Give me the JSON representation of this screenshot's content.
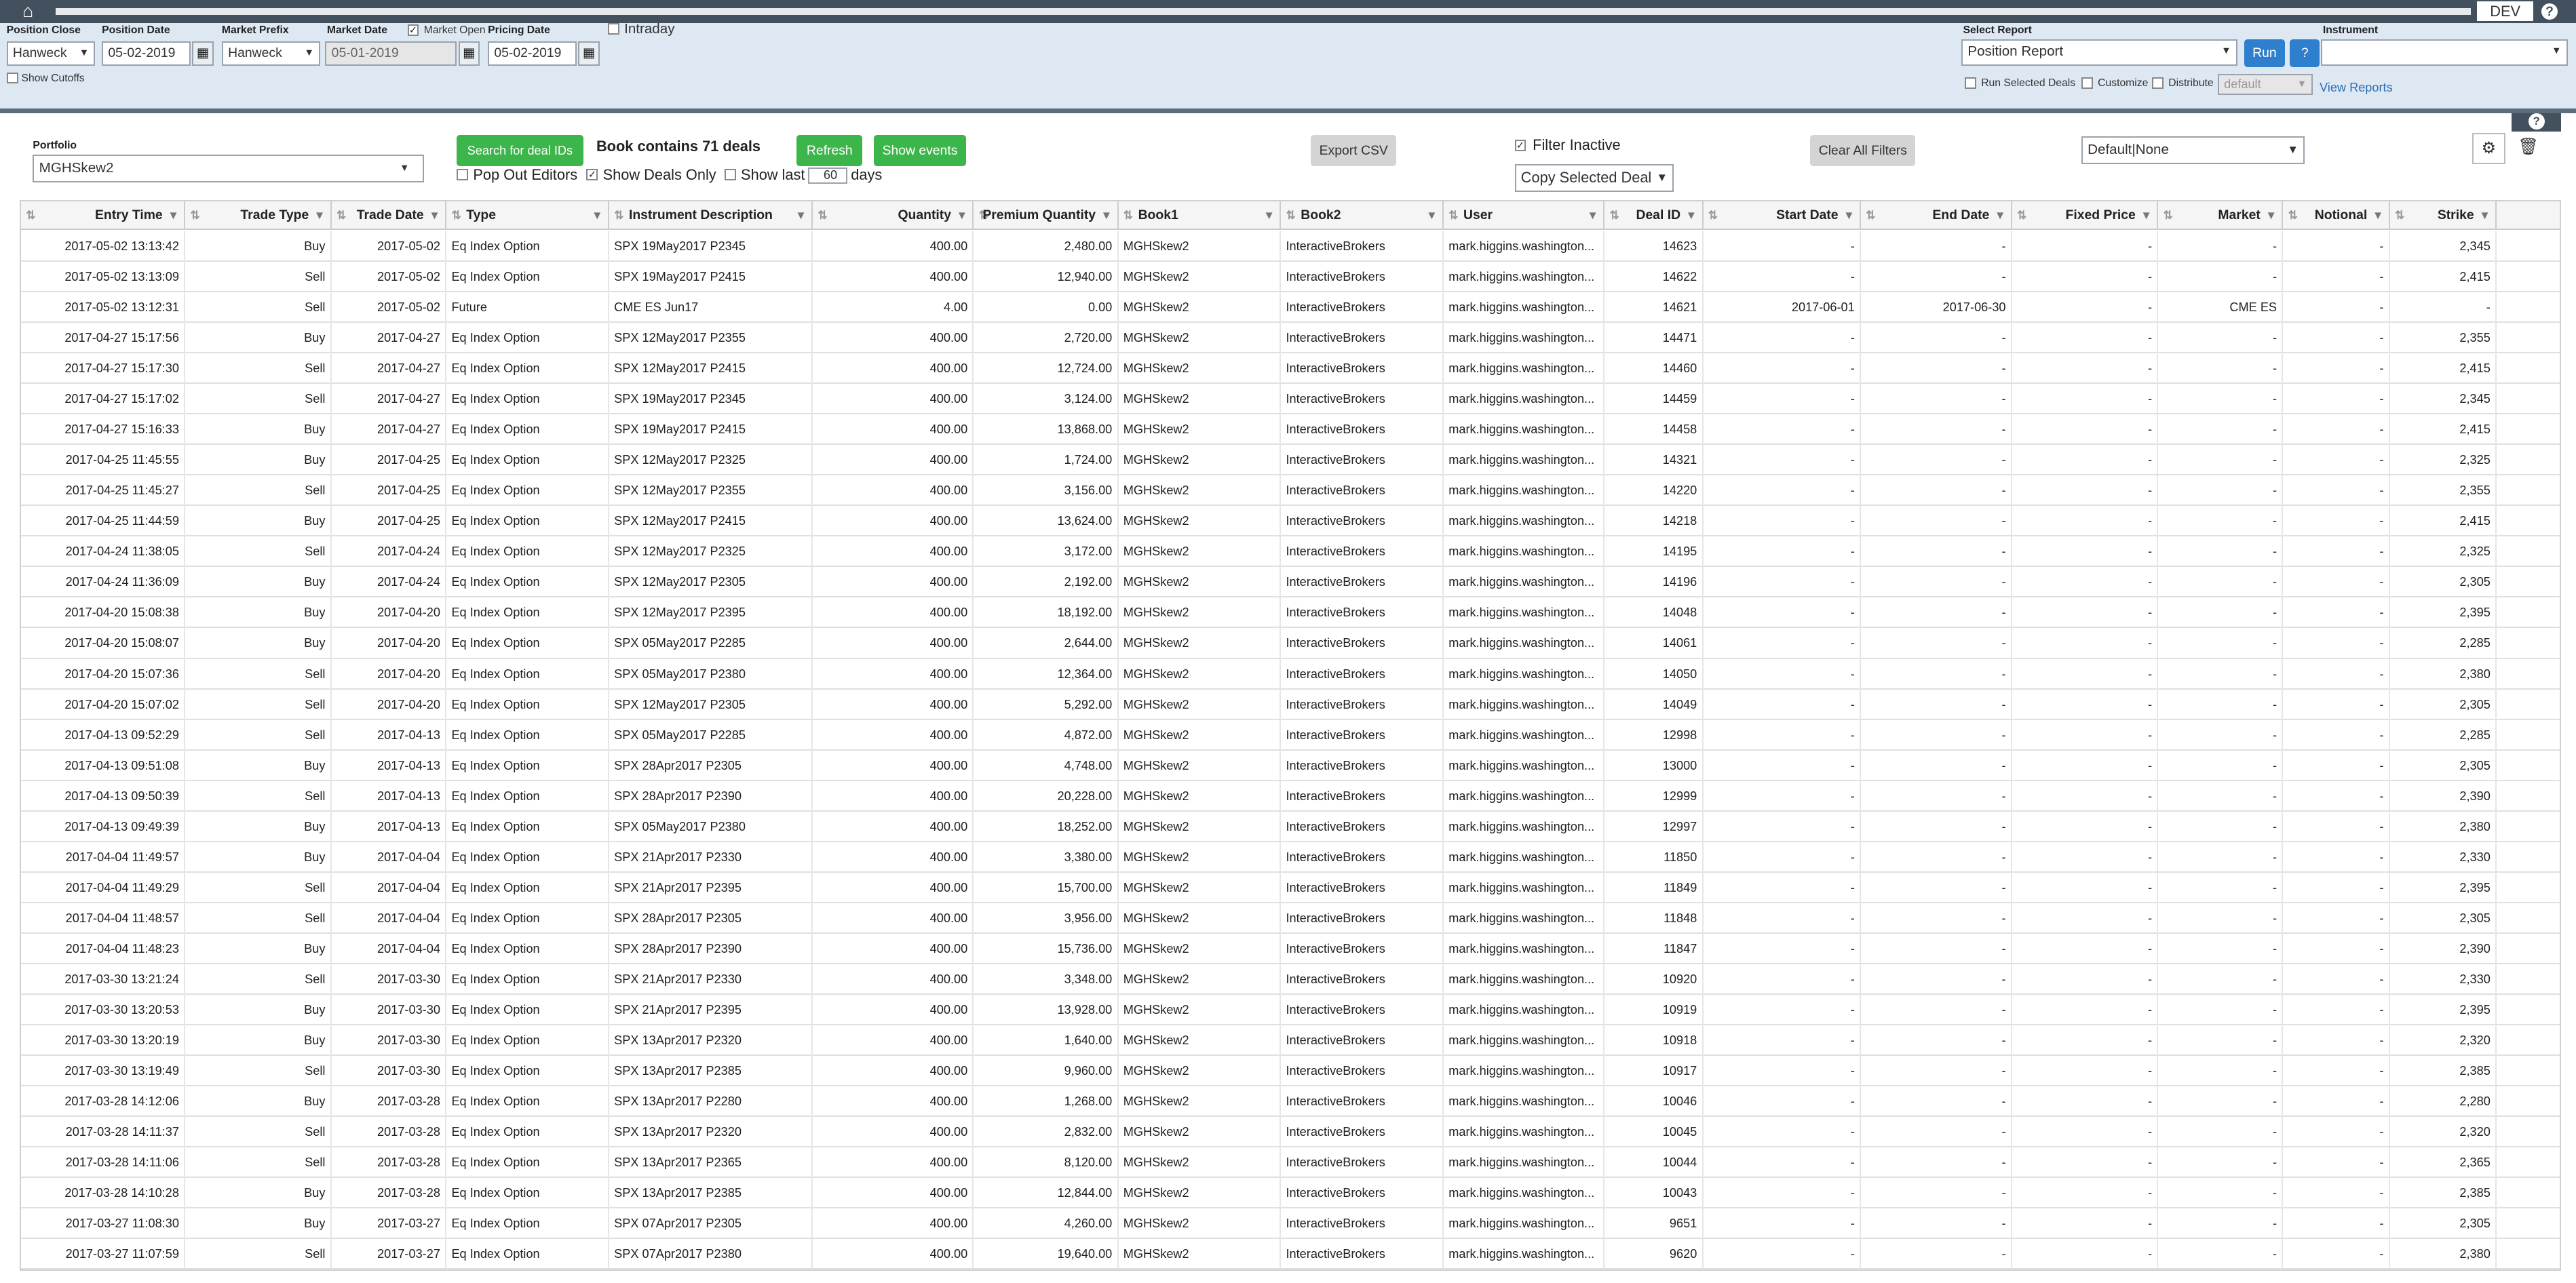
{
  "topbar": {
    "home_icon": "home-icon",
    "env": "DEV",
    "help": "?"
  },
  "filters": {
    "position_close": {
      "label": "Position Close",
      "value": "Hanweck"
    },
    "position_date": {
      "label": "Position Date",
      "value": "05-02-2019"
    },
    "market_prefix": {
      "label": "Market Prefix",
      "value": "Hanweck"
    },
    "market_date": {
      "label": "Market Date",
      "value": "05-01-2019"
    },
    "market_open": {
      "label": "Market Open",
      "checked": true
    },
    "pricing_date": {
      "label": "Pricing Date",
      "value": "05-02-2019"
    },
    "intraday": {
      "label": "Intraday",
      "checked": false
    },
    "show_cutoffs": {
      "label": "Show Cutoffs",
      "checked": false
    }
  },
  "report": {
    "label": "Select Report",
    "value": "Position Report",
    "run": "Run",
    "help": "?",
    "instrument_label": "Instrument",
    "instrument_value": "",
    "run_selected": "Run Selected Deals",
    "customize": "Customize",
    "distribute": "Distribute",
    "distribute_value": "default",
    "view_reports": "View Reports"
  },
  "toolbar": {
    "portfolio_label": "Portfolio",
    "portfolio_value": "MGHSkew2",
    "search_deal_ids": "Search for deal IDs",
    "book_info": "Book contains 71 deals",
    "refresh": "Refresh",
    "show_events": "Show events",
    "pop_out_editors": "Pop Out Editors",
    "show_deals_only": "Show Deals Only",
    "show_last": "Show last",
    "show_last_days": "60",
    "days": "days",
    "export_csv": "Export CSV",
    "filter_inactive": "Filter Inactive",
    "copy_selected_deal": "Copy Selected Deal",
    "clear_all_filters": "Clear All Filters",
    "layout_value": "Default|None"
  },
  "grid": {
    "columns": [
      "Entry Time",
      "Trade Type",
      "Trade Date",
      "Type",
      "Instrument Description",
      "Quantity",
      "Premium Quantity",
      "Book1",
      "Book2",
      "User",
      "Deal ID",
      "Start Date",
      "End Date",
      "Fixed Price",
      "Market",
      "Notional",
      "Strike"
    ],
    "rows": [
      [
        "2017-05-02 13:13:42",
        "Buy",
        "2017-05-02",
        "Eq Index Option",
        "SPX 19May2017 P2345",
        "400.00",
        "2,480.00",
        "MGHSkew2",
        "InteractiveBrokers",
        "mark.higgins.washington...",
        "14623",
        "-",
        "-",
        "-",
        "-",
        "-",
        "2,345"
      ],
      [
        "2017-05-02 13:13:09",
        "Sell",
        "2017-05-02",
        "Eq Index Option",
        "SPX 19May2017 P2415",
        "400.00",
        "12,940.00",
        "MGHSkew2",
        "InteractiveBrokers",
        "mark.higgins.washington...",
        "14622",
        "-",
        "-",
        "-",
        "-",
        "-",
        "2,415"
      ],
      [
        "2017-05-02 13:12:31",
        "Sell",
        "2017-05-02",
        "Future",
        "CME ES Jun17",
        "4.00",
        "0.00",
        "MGHSkew2",
        "InteractiveBrokers",
        "mark.higgins.washington...",
        "14621",
        "2017-06-01",
        "2017-06-30",
        "-",
        "CME ES",
        "-",
        "-"
      ],
      [
        "2017-04-27 15:17:56",
        "Buy",
        "2017-04-27",
        "Eq Index Option",
        "SPX 12May2017 P2355",
        "400.00",
        "2,720.00",
        "MGHSkew2",
        "InteractiveBrokers",
        "mark.higgins.washington...",
        "14471",
        "-",
        "-",
        "-",
        "-",
        "-",
        "2,355"
      ],
      [
        "2017-04-27 15:17:30",
        "Sell",
        "2017-04-27",
        "Eq Index Option",
        "SPX 12May2017 P2415",
        "400.00",
        "12,724.00",
        "MGHSkew2",
        "InteractiveBrokers",
        "mark.higgins.washington...",
        "14460",
        "-",
        "-",
        "-",
        "-",
        "-",
        "2,415"
      ],
      [
        "2017-04-27 15:17:02",
        "Sell",
        "2017-04-27",
        "Eq Index Option",
        "SPX 19May2017 P2345",
        "400.00",
        "3,124.00",
        "MGHSkew2",
        "InteractiveBrokers",
        "mark.higgins.washington...",
        "14459",
        "-",
        "-",
        "-",
        "-",
        "-",
        "2,345"
      ],
      [
        "2017-04-27 15:16:33",
        "Buy",
        "2017-04-27",
        "Eq Index Option",
        "SPX 19May2017 P2415",
        "400.00",
        "13,868.00",
        "MGHSkew2",
        "InteractiveBrokers",
        "mark.higgins.washington...",
        "14458",
        "-",
        "-",
        "-",
        "-",
        "-",
        "2,415"
      ],
      [
        "2017-04-25 11:45:55",
        "Buy",
        "2017-04-25",
        "Eq Index Option",
        "SPX 12May2017 P2325",
        "400.00",
        "1,724.00",
        "MGHSkew2",
        "InteractiveBrokers",
        "mark.higgins.washington...",
        "14321",
        "-",
        "-",
        "-",
        "-",
        "-",
        "2,325"
      ],
      [
        "2017-04-25 11:45:27",
        "Sell",
        "2017-04-25",
        "Eq Index Option",
        "SPX 12May2017 P2355",
        "400.00",
        "3,156.00",
        "MGHSkew2",
        "InteractiveBrokers",
        "mark.higgins.washington...",
        "14220",
        "-",
        "-",
        "-",
        "-",
        "-",
        "2,355"
      ],
      [
        "2017-04-25 11:44:59",
        "Buy",
        "2017-04-25",
        "Eq Index Option",
        "SPX 12May2017 P2415",
        "400.00",
        "13,624.00",
        "MGHSkew2",
        "InteractiveBrokers",
        "mark.higgins.washington...",
        "14218",
        "-",
        "-",
        "-",
        "-",
        "-",
        "2,415"
      ],
      [
        "2017-04-24 11:38:05",
        "Sell",
        "2017-04-24",
        "Eq Index Option",
        "SPX 12May2017 P2325",
        "400.00",
        "3,172.00",
        "MGHSkew2",
        "InteractiveBrokers",
        "mark.higgins.washington...",
        "14195",
        "-",
        "-",
        "-",
        "-",
        "-",
        "2,325"
      ],
      [
        "2017-04-24 11:36:09",
        "Buy",
        "2017-04-24",
        "Eq Index Option",
        "SPX 12May2017 P2305",
        "400.00",
        "2,192.00",
        "MGHSkew2",
        "InteractiveBrokers",
        "mark.higgins.washington...",
        "14196",
        "-",
        "-",
        "-",
        "-",
        "-",
        "2,305"
      ],
      [
        "2017-04-20 15:08:38",
        "Buy",
        "2017-04-20",
        "Eq Index Option",
        "SPX 12May2017 P2395",
        "400.00",
        "18,192.00",
        "MGHSkew2",
        "InteractiveBrokers",
        "mark.higgins.washington...",
        "14048",
        "-",
        "-",
        "-",
        "-",
        "-",
        "2,395"
      ],
      [
        "2017-04-20 15:08:07",
        "Buy",
        "2017-04-20",
        "Eq Index Option",
        "SPX 05May2017 P2285",
        "400.00",
        "2,644.00",
        "MGHSkew2",
        "InteractiveBrokers",
        "mark.higgins.washington...",
        "14061",
        "-",
        "-",
        "-",
        "-",
        "-",
        "2,285"
      ],
      [
        "2017-04-20 15:07:36",
        "Sell",
        "2017-04-20",
        "Eq Index Option",
        "SPX 05May2017 P2380",
        "400.00",
        "12,364.00",
        "MGHSkew2",
        "InteractiveBrokers",
        "mark.higgins.washington...",
        "14050",
        "-",
        "-",
        "-",
        "-",
        "-",
        "2,380"
      ],
      [
        "2017-04-20 15:07:02",
        "Sell",
        "2017-04-20",
        "Eq Index Option",
        "SPX 12May2017 P2305",
        "400.00",
        "5,292.00",
        "MGHSkew2",
        "InteractiveBrokers",
        "mark.higgins.washington...",
        "14049",
        "-",
        "-",
        "-",
        "-",
        "-",
        "2,305"
      ],
      [
        "2017-04-13 09:52:29",
        "Sell",
        "2017-04-13",
        "Eq Index Option",
        "SPX 05May2017 P2285",
        "400.00",
        "4,872.00",
        "MGHSkew2",
        "InteractiveBrokers",
        "mark.higgins.washington...",
        "12998",
        "-",
        "-",
        "-",
        "-",
        "-",
        "2,285"
      ],
      [
        "2017-04-13 09:51:08",
        "Buy",
        "2017-04-13",
        "Eq Index Option",
        "SPX 28Apr2017 P2305",
        "400.00",
        "4,748.00",
        "MGHSkew2",
        "InteractiveBrokers",
        "mark.higgins.washington...",
        "13000",
        "-",
        "-",
        "-",
        "-",
        "-",
        "2,305"
      ],
      [
        "2017-04-13 09:50:39",
        "Sell",
        "2017-04-13",
        "Eq Index Option",
        "SPX 28Apr2017 P2390",
        "400.00",
        "20,228.00",
        "MGHSkew2",
        "InteractiveBrokers",
        "mark.higgins.washington...",
        "12999",
        "-",
        "-",
        "-",
        "-",
        "-",
        "2,390"
      ],
      [
        "2017-04-13 09:49:39",
        "Buy",
        "2017-04-13",
        "Eq Index Option",
        "SPX 05May2017 P2380",
        "400.00",
        "18,252.00",
        "MGHSkew2",
        "InteractiveBrokers",
        "mark.higgins.washington...",
        "12997",
        "-",
        "-",
        "-",
        "-",
        "-",
        "2,380"
      ],
      [
        "2017-04-04 11:49:57",
        "Buy",
        "2017-04-04",
        "Eq Index Option",
        "SPX 21Apr2017 P2330",
        "400.00",
        "3,380.00",
        "MGHSkew2",
        "InteractiveBrokers",
        "mark.higgins.washington...",
        "11850",
        "-",
        "-",
        "-",
        "-",
        "-",
        "2,330"
      ],
      [
        "2017-04-04 11:49:29",
        "Sell",
        "2017-04-04",
        "Eq Index Option",
        "SPX 21Apr2017 P2395",
        "400.00",
        "15,700.00",
        "MGHSkew2",
        "InteractiveBrokers",
        "mark.higgins.washington...",
        "11849",
        "-",
        "-",
        "-",
        "-",
        "-",
        "2,395"
      ],
      [
        "2017-04-04 11:48:57",
        "Sell",
        "2017-04-04",
        "Eq Index Option",
        "SPX 28Apr2017 P2305",
        "400.00",
        "3,956.00",
        "MGHSkew2",
        "InteractiveBrokers",
        "mark.higgins.washington...",
        "11848",
        "-",
        "-",
        "-",
        "-",
        "-",
        "2,305"
      ],
      [
        "2017-04-04 11:48:23",
        "Buy",
        "2017-04-04",
        "Eq Index Option",
        "SPX 28Apr2017 P2390",
        "400.00",
        "15,736.00",
        "MGHSkew2",
        "InteractiveBrokers",
        "mark.higgins.washington...",
        "11847",
        "-",
        "-",
        "-",
        "-",
        "-",
        "2,390"
      ],
      [
        "2017-03-30 13:21:24",
        "Sell",
        "2017-03-30",
        "Eq Index Option",
        "SPX 21Apr2017 P2330",
        "400.00",
        "3,348.00",
        "MGHSkew2",
        "InteractiveBrokers",
        "mark.higgins.washington...",
        "10920",
        "-",
        "-",
        "-",
        "-",
        "-",
        "2,330"
      ],
      [
        "2017-03-30 13:20:53",
        "Buy",
        "2017-03-30",
        "Eq Index Option",
        "SPX 21Apr2017 P2395",
        "400.00",
        "13,928.00",
        "MGHSkew2",
        "InteractiveBrokers",
        "mark.higgins.washington...",
        "10919",
        "-",
        "-",
        "-",
        "-",
        "-",
        "2,395"
      ],
      [
        "2017-03-30 13:20:19",
        "Buy",
        "2017-03-30",
        "Eq Index Option",
        "SPX 13Apr2017 P2320",
        "400.00",
        "1,640.00",
        "MGHSkew2",
        "InteractiveBrokers",
        "mark.higgins.washington...",
        "10918",
        "-",
        "-",
        "-",
        "-",
        "-",
        "2,320"
      ],
      [
        "2017-03-30 13:19:49",
        "Sell",
        "2017-03-30",
        "Eq Index Option",
        "SPX 13Apr2017 P2385",
        "400.00",
        "9,960.00",
        "MGHSkew2",
        "InteractiveBrokers",
        "mark.higgins.washington...",
        "10917",
        "-",
        "-",
        "-",
        "-",
        "-",
        "2,385"
      ],
      [
        "2017-03-28 14:12:06",
        "Buy",
        "2017-03-28",
        "Eq Index Option",
        "SPX 13Apr2017 P2280",
        "400.00",
        "1,268.00",
        "MGHSkew2",
        "InteractiveBrokers",
        "mark.higgins.washington...",
        "10046",
        "-",
        "-",
        "-",
        "-",
        "-",
        "2,280"
      ],
      [
        "2017-03-28 14:11:37",
        "Sell",
        "2017-03-28",
        "Eq Index Option",
        "SPX 13Apr2017 P2320",
        "400.00",
        "2,832.00",
        "MGHSkew2",
        "InteractiveBrokers",
        "mark.higgins.washington...",
        "10045",
        "-",
        "-",
        "-",
        "-",
        "-",
        "2,320"
      ],
      [
        "2017-03-28 14:11:06",
        "Sell",
        "2017-03-28",
        "Eq Index Option",
        "SPX 13Apr2017 P2365",
        "400.00",
        "8,120.00",
        "MGHSkew2",
        "InteractiveBrokers",
        "mark.higgins.washington...",
        "10044",
        "-",
        "-",
        "-",
        "-",
        "-",
        "2,365"
      ],
      [
        "2017-03-28 14:10:28",
        "Buy",
        "2017-03-28",
        "Eq Index Option",
        "SPX 13Apr2017 P2385",
        "400.00",
        "12,844.00",
        "MGHSkew2",
        "InteractiveBrokers",
        "mark.higgins.washington...",
        "10043",
        "-",
        "-",
        "-",
        "-",
        "-",
        "2,385"
      ],
      [
        "2017-03-27 11:08:30",
        "Buy",
        "2017-03-27",
        "Eq Index Option",
        "SPX 07Apr2017 P2305",
        "400.00",
        "4,260.00",
        "MGHSkew2",
        "InteractiveBrokers",
        "mark.higgins.washington...",
        "9651",
        "-",
        "-",
        "-",
        "-",
        "-",
        "2,305"
      ],
      [
        "2017-03-27 11:07:59",
        "Sell",
        "2017-03-27",
        "Eq Index Option",
        "SPX 07Apr2017 P2380",
        "400.00",
        "19,640.00",
        "MGHSkew2",
        "InteractiveBrokers",
        "mark.higgins.washington...",
        "9620",
        "-",
        "-",
        "-",
        "-",
        "-",
        "2,380"
      ]
    ]
  }
}
